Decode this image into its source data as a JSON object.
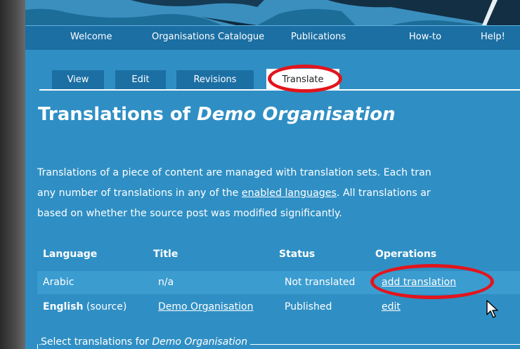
{
  "nav": {
    "items": [
      "Welcome",
      "Organisations Catalogue",
      "Publications",
      "How-to",
      "Help!"
    ]
  },
  "tabs": [
    {
      "label": "View"
    },
    {
      "label": "Edit"
    },
    {
      "label": "Revisions"
    },
    {
      "label": "Translate",
      "active": true
    }
  ],
  "page": {
    "title_prefix": "Translations of ",
    "title_node": "Demo Organisation",
    "intro_line1": "Translations of a piece of content are managed with translation sets. Each tran",
    "intro_line2_a": "any number of translations in any of the ",
    "intro_link": "enabled languages",
    "intro_line2_b": ". All translations ar",
    "intro_line3": "based on whether the source post was modified significantly."
  },
  "table": {
    "headers": [
      "Language",
      "Title",
      "Status",
      "Operations"
    ],
    "rows": [
      {
        "language": "Arabic",
        "language_suffix": "",
        "title": "n/a",
        "status": "Not translated",
        "operation": "add translation"
      },
      {
        "language": "English",
        "language_suffix": " (source)",
        "title": "Demo Organisation",
        "status": "Published",
        "operation": "edit"
      }
    ]
  },
  "fieldset": {
    "legend_prefix": "Select translations for ",
    "legend_node": "Demo Organisation"
  },
  "colors": {
    "page_bg": "#2f8fc4",
    "nav_bg": "#1b6fa3",
    "highlight": "#e2151c"
  }
}
